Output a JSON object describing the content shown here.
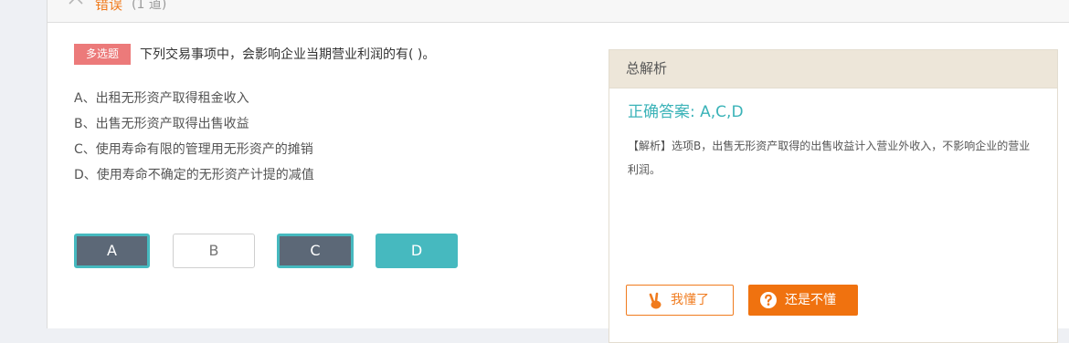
{
  "section": {
    "title": "错误",
    "count": "(1 道)"
  },
  "question": {
    "type_label": "多选题",
    "text": "下列交易事项中，会影响企业当期营业利润的有( )。",
    "options": [
      "A、出租无形资产取得租金收入",
      "B、出售无形资产取得出售收益",
      "C、使用寿命有限的管理用无形资产的摊销",
      "D、使用寿命不确定的无形资产计提的减值"
    ]
  },
  "answer_buttons": [
    {
      "label": "A",
      "state": "selected"
    },
    {
      "label": "B",
      "state": "unselected"
    },
    {
      "label": "C",
      "state": "selected"
    },
    {
      "label": "D",
      "state": "correct"
    }
  ],
  "analysis": {
    "title": "总解析",
    "correct_answer": "正确答案: A,C,D",
    "explanation": "【解析】选项B，出售无形资产取得的出售收益计入营业外收入，不影响企业的营业利润。",
    "understood_label": "我懂了",
    "not_understood_label": "还是不懂",
    "understood_icon": "victory-hand-icon",
    "not_understood_icon": "question-circle-icon"
  },
  "colors": {
    "accent_orange": "#f07b1e",
    "teal": "#46b9bf",
    "selected_gray": "#5c6877",
    "tag_red": "#ec7a7a"
  }
}
